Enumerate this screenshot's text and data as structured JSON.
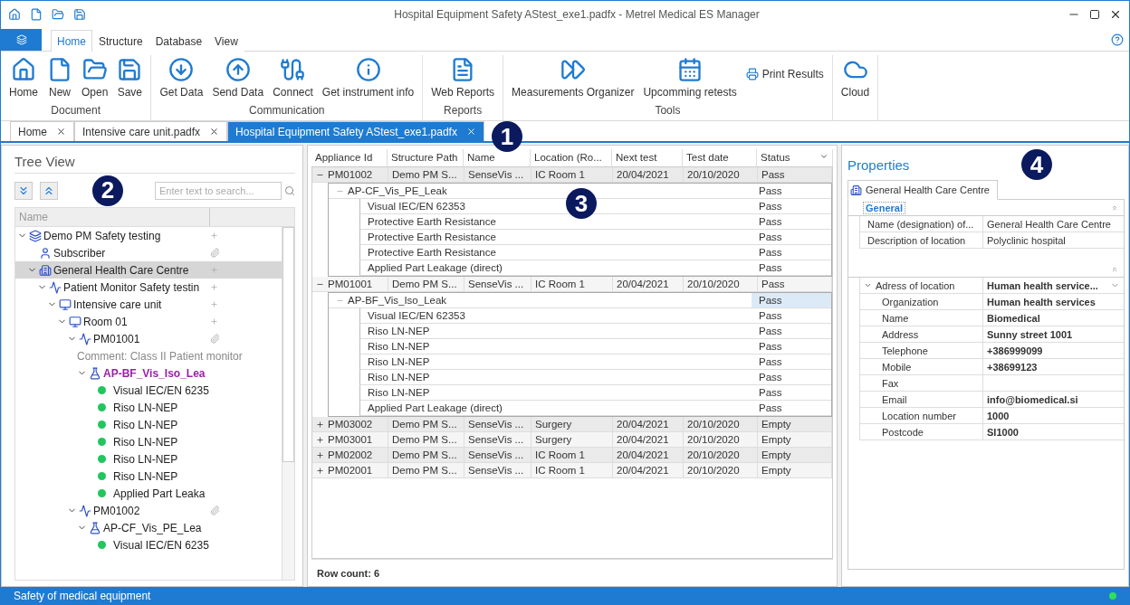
{
  "window": {
    "title": "Hospital Equipment Safety AStest_exe1.padfx - Metrel Medical ES Manager"
  },
  "ribbon_tabs": [
    {
      "label": "Home",
      "selected": true
    },
    {
      "label": "Structure",
      "selected": false
    },
    {
      "label": "Database",
      "selected": false
    },
    {
      "label": "View",
      "selected": false
    }
  ],
  "ribbon_groups": [
    {
      "title": "Document",
      "buttons": [
        "Home",
        "New",
        "Open",
        "Save"
      ]
    },
    {
      "title": "Communication",
      "buttons": [
        "Get Data",
        "Send Data",
        "Connect",
        "Get instrument info"
      ]
    },
    {
      "title": "Reports",
      "buttons": [
        "Web Reports"
      ]
    },
    {
      "title": "Tools",
      "buttons": [
        "Measurements Organizer",
        "Upcomming retests",
        "Print Results"
      ]
    },
    {
      "buttons": [
        "Cloud"
      ]
    }
  ],
  "doc_tabs": [
    {
      "label": "Home",
      "selected": false
    },
    {
      "label": "Intensive care unit.padfx",
      "selected": false
    },
    {
      "label": "Hospital Equipment Safety AStest_exe1.padfx",
      "selected": true
    }
  ],
  "callouts": [
    "1",
    "2",
    "3",
    "4"
  ],
  "tree_view": {
    "title": "Tree View",
    "search": {
      "placeholder": "Enter text to search..."
    },
    "column": "Name",
    "items": [
      {
        "label": "Demo PM Safety testing",
        "kind": "project",
        "expanded": true,
        "selected": false,
        "addable": true,
        "children": [
          {
            "label": "Subscriber",
            "kind": "subscriber",
            "selected": false,
            "attachment": true
          },
          {
            "label": "General Health Care Centre",
            "kind": "location",
            "expanded": true,
            "selected": true,
            "addable": true,
            "children": [
              {
                "label": "Patient Monitor Safety testin",
                "kind": "procedure",
                "expanded": true,
                "selected": false,
                "addable": true,
                "children": [
                  {
                    "label": "Intensive care unit",
                    "kind": "department",
                    "expanded": true,
                    "selected": false,
                    "addable": true,
                    "children": [
                      {
                        "label": "Room 01",
                        "kind": "room",
                        "expanded": true,
                        "selected": false,
                        "addable": true,
                        "children": [
                          {
                            "label": "PM01001",
                            "kind": "device",
                            "expanded": true,
                            "selected": false,
                            "attachment": true,
                            "comment": "Comment: Class II Patient monitor",
                            "children": [
                              {
                                "label": "AP-BF_Vis_Iso_Lea",
                                "kind": "test",
                                "expanded": true,
                                "selected": false,
                                "highlighted": true,
                                "children": [
                                  {
                                    "label": "Visual IEC/EN 6235",
                                    "kind": "step",
                                    "color": "#22c55e",
                                    "selected": false
                                  },
                                  {
                                    "label": "Riso LN-NEP",
                                    "kind": "step",
                                    "color": "#22c55e",
                                    "selected": false
                                  },
                                  {
                                    "label": "Riso LN-NEP",
                                    "kind": "step",
                                    "color": "#22c55e",
                                    "selected": false
                                  },
                                  {
                                    "label": "Riso LN-NEP",
                                    "kind": "step",
                                    "color": "#22c55e",
                                    "selected": false
                                  },
                                  {
                                    "label": "Riso LN-NEP",
                                    "kind": "step",
                                    "color": "#22c55e",
                                    "selected": false
                                  },
                                  {
                                    "label": "Riso LN-NEP",
                                    "kind": "step",
                                    "color": "#22c55e",
                                    "selected": false
                                  },
                                  {
                                    "label": "Applied Part Leaka",
                                    "kind": "step",
                                    "color": "#22c55e",
                                    "selected": false
                                  }
                                ]
                              }
                            ]
                          },
                          {
                            "label": "PM01002",
                            "kind": "device",
                            "expanded": true,
                            "selected": false,
                            "attachment": true,
                            "children": [
                              {
                                "label": "AP-CF_Vis_PE_Lea",
                                "kind": "test",
                                "expanded": true,
                                "selected": false,
                                "highlighted": false,
                                "children": [
                                  {
                                    "label": "Visual IEC/EN 6235",
                                    "kind": "step",
                                    "color": "#22c55e",
                                    "selected": false
                                  }
                                ]
                              }
                            ]
                          }
                        ]
                      }
                    ]
                  }
                ]
              }
            ]
          }
        ]
      }
    ]
  },
  "grid": {
    "columns": [
      "Appliance Id",
      "Structure Path",
      "Name",
      "Location (Ro...",
      "Next test",
      "Test date",
      "Status"
    ],
    "rows": [
      {
        "expanded": true,
        "cells": [
          "PM01002",
          "Demo PM S...",
          "SenseVis ...",
          "IC Room 1",
          "20/04/2021",
          "20/10/2020",
          "Pass"
        ],
        "groups": [
          {
            "name": "AP-CF_Vis_PE_Leak",
            "status": "Pass",
            "selected": false,
            "steps": [
              {
                "name": "Visual IEC/EN 62353",
                "status": "Pass"
              },
              {
                "name": "Protective Earth Resistance",
                "status": "Pass"
              },
              {
                "name": "Protective Earth Resistance",
                "status": "Pass"
              },
              {
                "name": "Protective Earth Resistance",
                "status": "Pass"
              },
              {
                "name": "Applied Part Leakage (direct)",
                "status": "Pass"
              }
            ]
          }
        ]
      },
      {
        "expanded": true,
        "cells": [
          "PM01001",
          "Demo PM S...",
          "SenseVis ...",
          "IC Room 1",
          "20/04/2021",
          "20/10/2020",
          "Pass"
        ],
        "groups": [
          {
            "name": "AP-BF_Vis_Iso_Leak",
            "status": "Pass",
            "selected": true,
            "steps": [
              {
                "name": "Visual IEC/EN 62353",
                "status": "Pass"
              },
              {
                "name": "Riso LN-NEP",
                "status": "Pass"
              },
              {
                "name": "Riso LN-NEP",
                "status": "Pass"
              },
              {
                "name": "Riso LN-NEP",
                "status": "Pass"
              },
              {
                "name": "Riso LN-NEP",
                "status": "Pass"
              },
              {
                "name": "Riso LN-NEP",
                "status": "Pass"
              },
              {
                "name": "Applied Part Leakage (direct)",
                "status": "Pass"
              }
            ]
          }
        ]
      },
      {
        "expanded": false,
        "cells": [
          "PM03002",
          "Demo PM S...",
          "SenseVis ...",
          "Surgery",
          "20/04/2021",
          "20/10/2020",
          "Empty"
        ]
      },
      {
        "expanded": false,
        "cells": [
          "PM03001",
          "Demo PM S...",
          "SenseVis ...",
          "Surgery",
          "20/04/2021",
          "20/10/2020",
          "Empty"
        ]
      },
      {
        "expanded": false,
        "cells": [
          "PM02002",
          "Demo PM S...",
          "SenseVis ...",
          "IC Room 1",
          "20/04/2021",
          "20/10/2020",
          "Empty"
        ]
      },
      {
        "expanded": false,
        "cells": [
          "PM02001",
          "Demo PM S...",
          "SenseVis ...",
          "IC Room 1",
          "20/04/2021",
          "20/10/2020",
          "Empty"
        ]
      }
    ],
    "row_count": "Row count: 6"
  },
  "properties": {
    "title": "Properties",
    "tab": "General Health Care Centre",
    "categories": [
      {
        "title": "General",
        "rows": [
          {
            "name": "Name (designation) of...",
            "value": "General Health Care Centre"
          },
          {
            "name": "Description of location",
            "value": "Polyclinic hospital"
          }
        ]
      },
      {
        "rows": [
          {
            "name": "Adress of location",
            "value": "Human health service...",
            "expanded": true,
            "children": [
              {
                "name": "Organization",
                "value": "Human health services"
              },
              {
                "name": "Name",
                "value": "Biomedical"
              },
              {
                "name": "Address",
                "value": "Sunny street 1001"
              },
              {
                "name": "Telephone",
                "value": "+386999099"
              },
              {
                "name": "Mobile",
                "value": "+38699123"
              },
              {
                "name": "Fax"
              },
              {
                "name": "Email",
                "value": "info@biomedical.si"
              },
              {
                "name": "Location number",
                "value": "1000"
              },
              {
                "name": "Postcode",
                "value": "SI1000"
              }
            ]
          }
        ]
      }
    ]
  },
  "status_bar": {
    "text": "Safety of medical equipment",
    "connected": true
  }
}
